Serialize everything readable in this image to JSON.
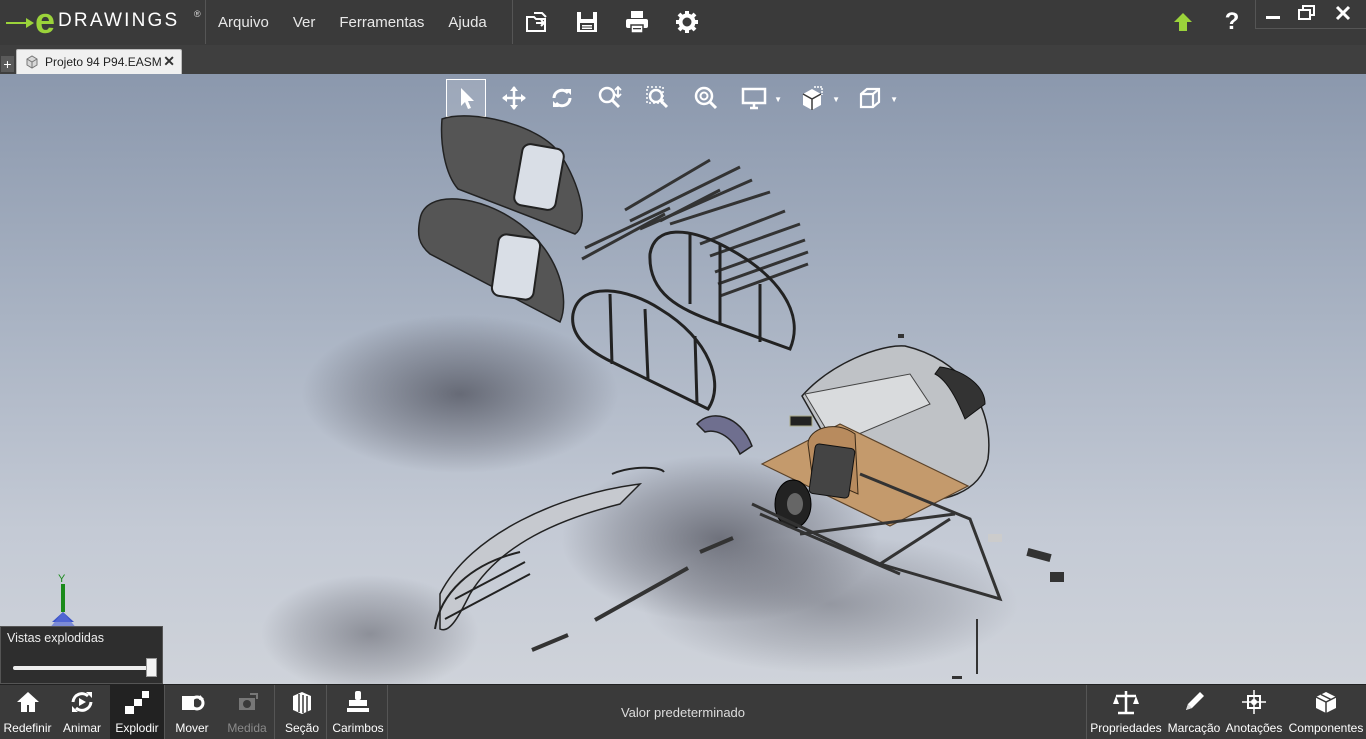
{
  "app": {
    "logo_text": "DRAWINGS",
    "logo_mark": "e"
  },
  "menu": [
    "Arquivo",
    "Ver",
    "Ferramentas",
    "Ajuda"
  ],
  "toolbar_icons": [
    "open-icon",
    "save-icon",
    "print-icon",
    "settings-icon"
  ],
  "right_icons": [
    "update-icon",
    "help-icon"
  ],
  "tab": {
    "label": "Projeto 94 P94.EASM",
    "close": "✕",
    "new": "+"
  },
  "view_toolbar": [
    "select",
    "pan",
    "rotate",
    "zoom-to-fit",
    "zoom-to-area",
    "zoom",
    "display-style",
    "view-orientation",
    "views"
  ],
  "explode_panel": {
    "title": "Vistas explodidas",
    "value": 1.0
  },
  "axes": {
    "y_label": "Y"
  },
  "bottom_left": [
    "Redefinir",
    "Animar",
    "Explodir",
    "Mover",
    "Medida",
    "Seção",
    "Carimbos"
  ],
  "status_text": "Valor predeterminado",
  "bottom_right": [
    "Propriedades",
    "Marcação",
    "Anotações",
    "Componentes"
  ],
  "colors": {
    "accent_green": "#9bd33a",
    "bar": "#3a3a3a"
  }
}
